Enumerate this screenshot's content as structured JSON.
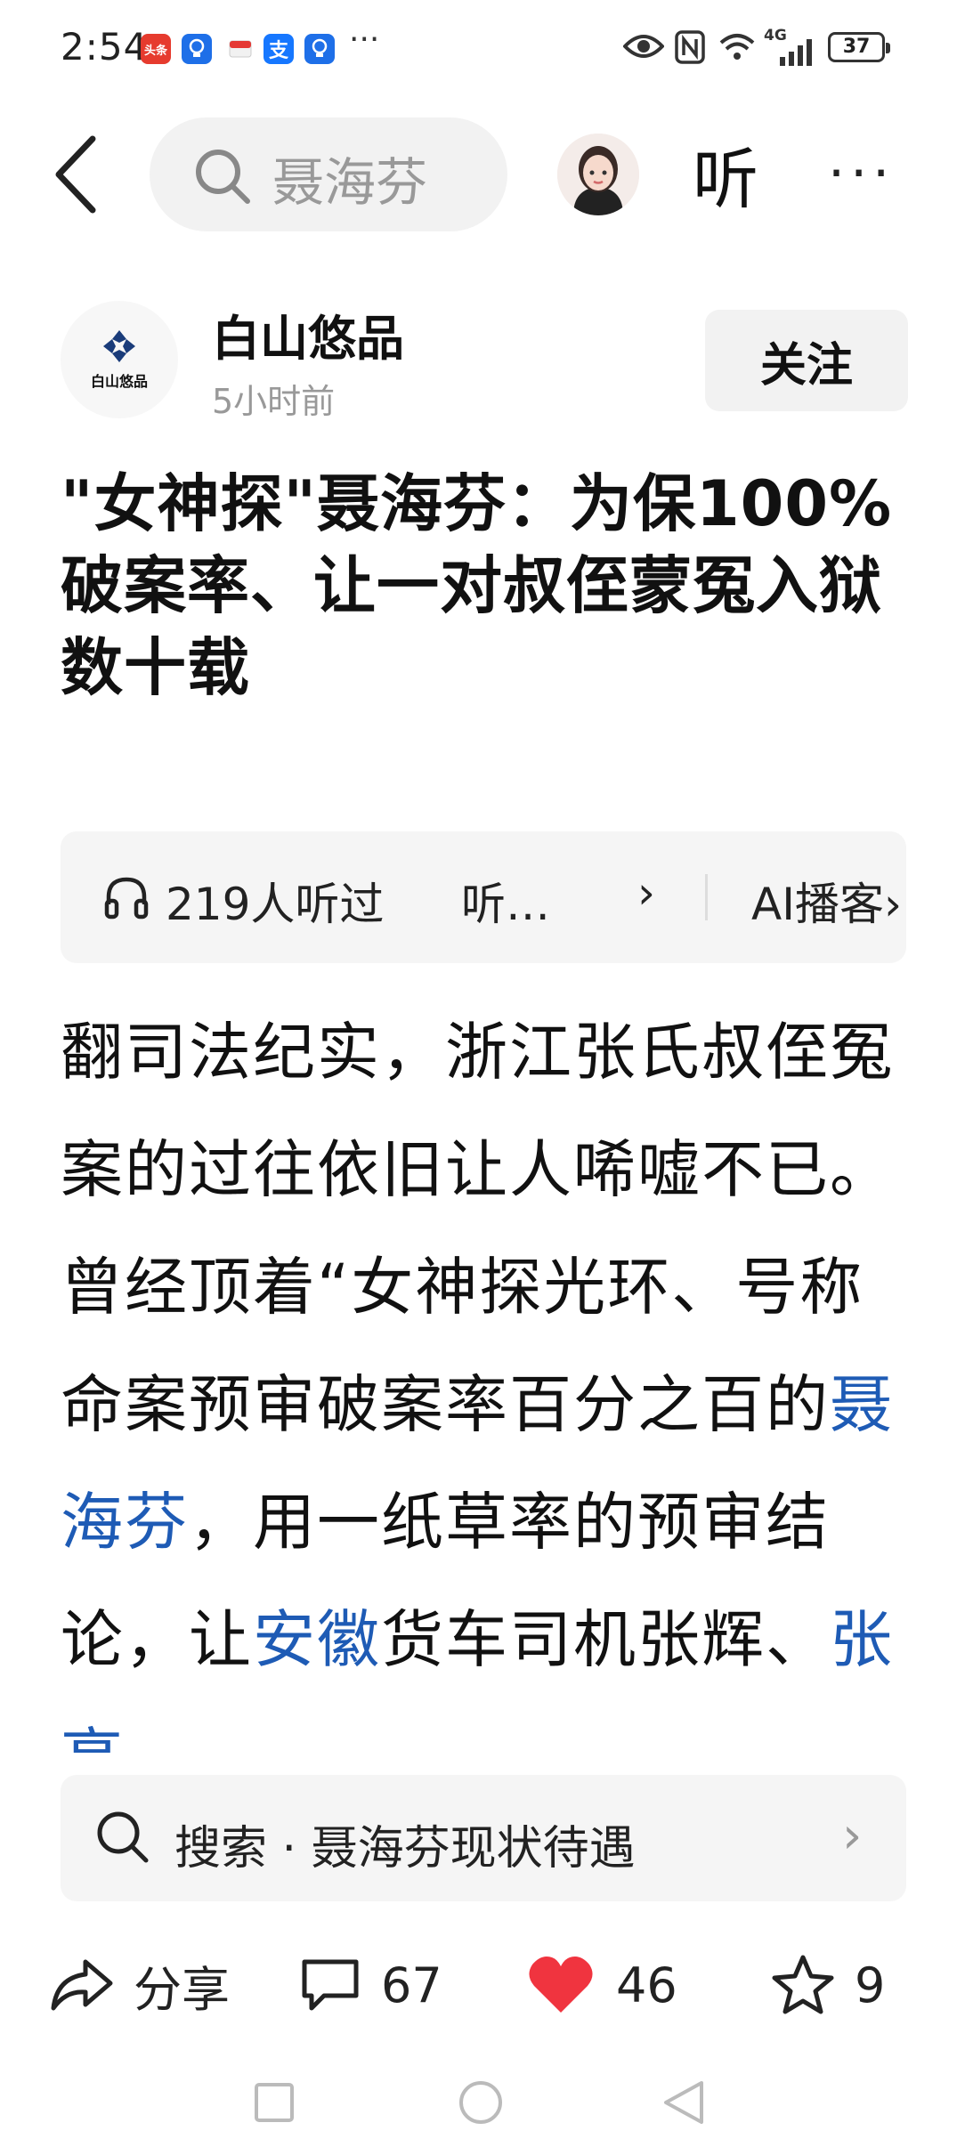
{
  "status_bar": {
    "time": "2:54",
    "icons": [
      "toutiao-icon",
      "bulb-icon",
      "envelope-icon",
      "alipay-icon",
      "bulb-icon"
    ],
    "more": "···",
    "network": "4G",
    "battery": "37"
  },
  "header": {
    "search_text": "聂海芬",
    "listen_label": "听",
    "more_label": "···"
  },
  "author": {
    "logo_text": "白山悠品",
    "name": "白山悠品",
    "time_ago": "5小时前",
    "follow_label": "关注"
  },
  "article": {
    "title": "\"女神探\"聂海芬：为保100%破案率、让一对叔侄蒙冤入狱数十载",
    "audio": {
      "listens": "219人听过",
      "listen_btn": "听…",
      "chevron": "›",
      "ai_label": "AI播客›"
    },
    "body": {
      "p1": "翻司法纪实，浙江张氏叔侄冤案的过往依旧让人唏嘘不已。曾经顶着“女神探光环、号称命案预审破案率百分之百的",
      "link1": "聂海芬",
      "p2": "，用一纸草率的预审结论，让",
      "link2": "安徽",
      "p3": "货车司机张辉、",
      "link3": "张高"
    }
  },
  "suggest": {
    "text": "搜索 · 聂海芬现状待遇",
    "arrow": "›"
  },
  "actions": {
    "share": "分享",
    "comments": "67",
    "likes": "46",
    "favorites": "9"
  },
  "colors": {
    "link": "#1e5bb5",
    "like": "#f0343f",
    "grey_bg": "#f2f2f2"
  }
}
